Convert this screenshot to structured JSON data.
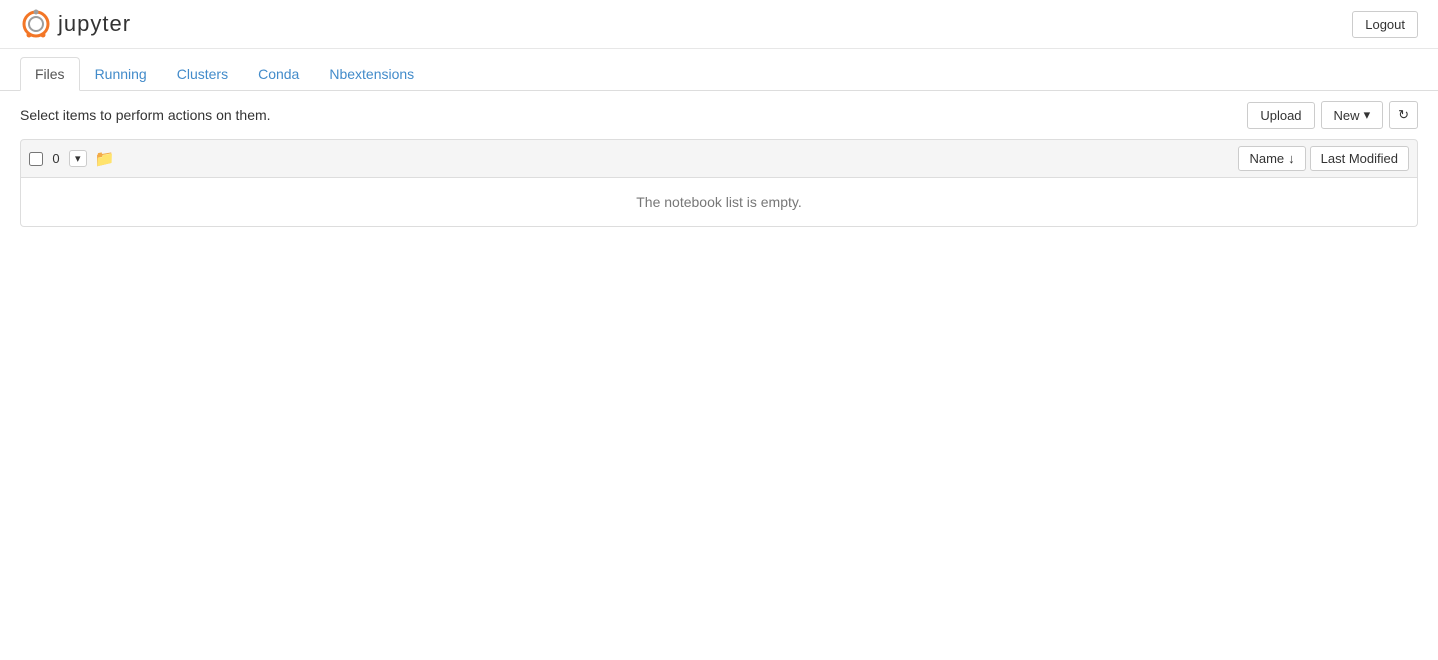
{
  "header": {
    "logout_label": "Logout",
    "logo_text": "jupyter"
  },
  "tabs": [
    {
      "id": "files",
      "label": "Files",
      "active": true
    },
    {
      "id": "running",
      "label": "Running",
      "active": false
    },
    {
      "id": "clusters",
      "label": "Clusters",
      "active": false
    },
    {
      "id": "conda",
      "label": "Conda",
      "active": false
    },
    {
      "id": "nbextensions",
      "label": "Nbextensions",
      "active": false
    }
  ],
  "toolbar": {
    "instruction": "Select items to perform actions on them.",
    "upload_label": "Upload",
    "new_label": "New",
    "new_dropdown_arrow": "▾",
    "refresh_icon": "↻"
  },
  "file_list": {
    "select_count": "0",
    "dropdown_arrow": "▾",
    "folder_icon": "📁",
    "name_sort_label": "Name",
    "name_sort_arrow": "↓",
    "last_modified_label": "Last Modified",
    "empty_message": "The notebook list is empty."
  }
}
